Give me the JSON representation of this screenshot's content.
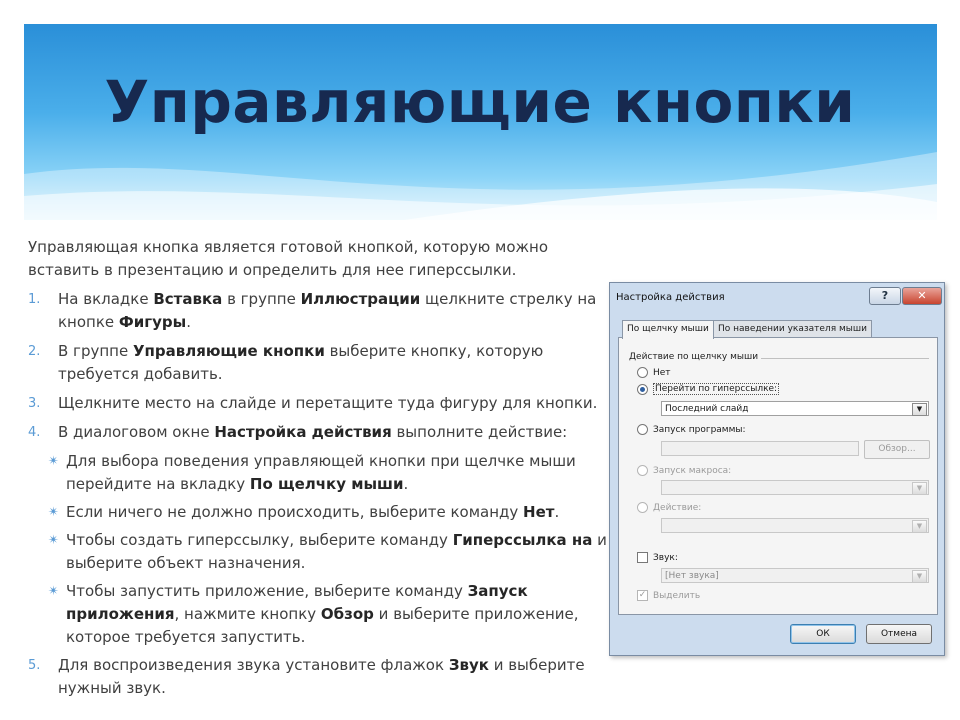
{
  "slide": {
    "title": "Управляющие кнопки",
    "intro": "Управляющая кнопка является готовой кнопкой, которую можно вставить в презентацию и определить для нее гиперссылки.",
    "step1": {
      "num": "1.",
      "t1": "На вкладке ",
      "b1": "Вставка",
      "t2": " в группе ",
      "b2": "Иллюстрации",
      "t3": " щелкните стрелку на кнопке ",
      "b3": "Фигуры",
      "t4": "."
    },
    "step2": {
      "num": "2.",
      "t1": "В группе ",
      "b1": "Управляющие кнопки",
      "t2": " выберите кнопку, которую требуется добавить."
    },
    "step3": {
      "num": "3.",
      "text": "Щелкните место на слайде и перетащите туда фигуру для кнопки."
    },
    "step4": {
      "num": "4.",
      "t1": "В диалоговом окне ",
      "b1": "Настройка действия",
      "t2": " выполните действие:"
    },
    "sub1": {
      "t1": "Для выбора поведения управляющей кнопки при щелчке мыши перейдите на вкладку ",
      "b1": "По щелчку мыши",
      "t2": "."
    },
    "sub2": {
      "t1": "Если ничего не должно происходить, выберите команду ",
      "b1": "Нет",
      "t2": "."
    },
    "sub3": {
      "t1": "Чтобы создать гиперссылку, выберите команду ",
      "b1": "Гиперссылка на",
      "t2": " и выберите объект назначения."
    },
    "sub4": {
      "t1": "Чтобы запустить приложение, выберите команду ",
      "b1": "Запуск приложения",
      "t2": ", нажмите кнопку ",
      "b2": "Обзор",
      "t3": " и выберите приложение, которое требуется запустить."
    },
    "step5": {
      "num": "5.",
      "t1": "Для воспроизведения звука установите флажок ",
      "b1": "Звук",
      "t2": " и выберите нужный звук."
    },
    "sub_marker": "✴"
  },
  "dialog": {
    "title": "Настройка действия",
    "help_label": "?",
    "close_label": "✕",
    "tab1": "По щелчку мыши",
    "tab2": "По наведении указателя мыши",
    "group_label": "Действие по щелчку мыши",
    "opt_none": "Нет",
    "opt_hyperlink": "Перейти по гиперссылке:",
    "hyperlink_value": "Последний слайд",
    "opt_program": "Запуск программы:",
    "browse_label": "Обзор...",
    "opt_macro": "Запуск макроса:",
    "opt_action": "Действие:",
    "chk_sound": "Звук:",
    "sound_value": "[Нет звука]",
    "chk_highlight": "Выделить",
    "check_mark": "✓",
    "dropdown_glyph": "▼",
    "ok_label": "ОК",
    "cancel_label": "Отмена"
  }
}
